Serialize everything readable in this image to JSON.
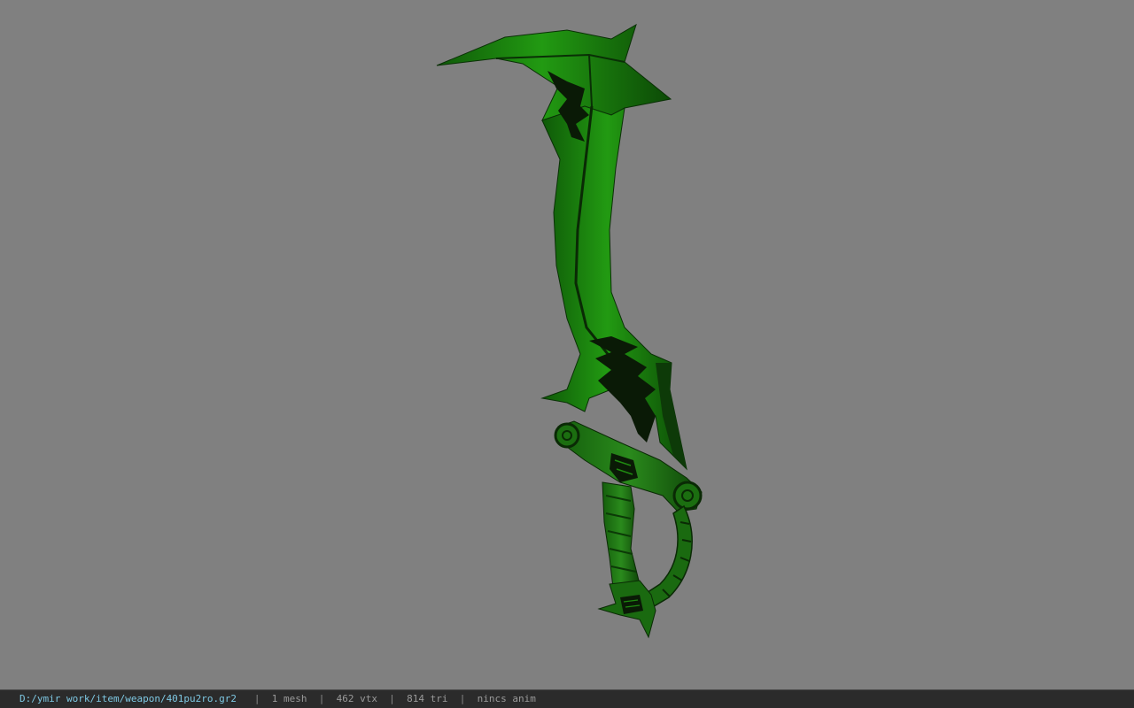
{
  "viewport": {
    "background": "#808080",
    "model": {
      "icon": "green-sword-model",
      "blade_color": "#1f8a10",
      "dark_color": "#0a2a08"
    }
  },
  "statusbar": {
    "file_path": "D:/ymir work/item/weapon/401pu2ro.gr2",
    "separator": "|",
    "mesh_count": "1 mesh",
    "vertex_count": "462 vtx",
    "triangle_count": "814 tri",
    "anim_status": "nincs anim",
    "path_color": "#7ec8e3"
  }
}
